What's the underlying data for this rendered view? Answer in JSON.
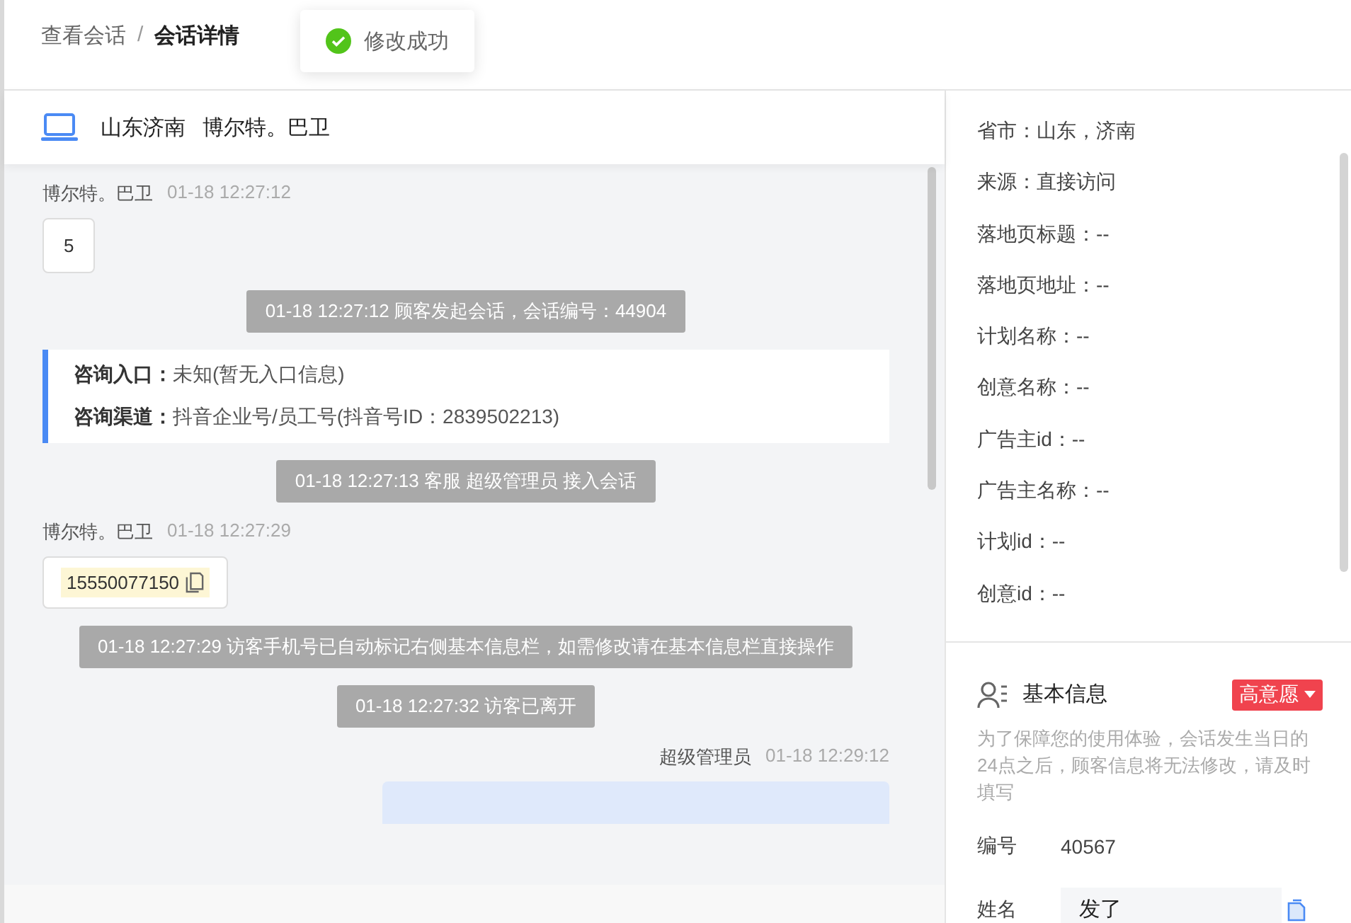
{
  "breadcrumb": [
    {
      "label": "查看会话",
      "current": false
    },
    {
      "label": "会话详情",
      "current": true
    }
  ],
  "breadcrumb_separator": "/",
  "toast": {
    "kind": "success",
    "text": "修改成功"
  },
  "visitor": {
    "location": "山东济南",
    "name": "博尔特。巴卫"
  },
  "messages": [
    {
      "kind": "visitor",
      "sender": "博尔特。巴卫",
      "time": "01-18 12:27:12",
      "text": "5"
    },
    {
      "kind": "system",
      "text": "01-18 12:27:12 顾客发起会话，会话编号：44904"
    },
    {
      "kind": "info",
      "lines": [
        {
          "label": "咨询入口：",
          "value": "未知(暂无入口信息)"
        },
        {
          "label": "咨询渠道：",
          "value": "抖音企业号/员工号(抖音号ID：2839502213)"
        }
      ]
    },
    {
      "kind": "system",
      "text": "01-18 12:27:13 客服 超级管理员 接入会话"
    },
    {
      "kind": "phone",
      "sender": "博尔特。巴卫",
      "time": "01-18 12:27:29",
      "text": "15550077150"
    },
    {
      "kind": "system",
      "text": "01-18 12:27:29 访客手机号已自动标记右侧基本信息栏，如需修改请在基本信息栏直接操作"
    },
    {
      "kind": "system",
      "text": "01-18 12:27:32 访客已离开"
    },
    {
      "kind": "agent",
      "sender": "超级管理员",
      "time": "01-18 12:29:12"
    }
  ],
  "details": [
    "省市：山东，济南",
    "来源：直接访问",
    "落地页标题：--",
    "落地页地址：--",
    "计划名称：--",
    "创意名称：--",
    "广告主id：--",
    "广告主名称：--",
    "计划id：--",
    "创意id：--"
  ],
  "basic_info": {
    "title": "基本信息",
    "intent": "高意愿",
    "note": "为了保障您的使用体验，会话发生当日的24点之后，顾客信息将无法修改，请及时填写",
    "fields": [
      {
        "kind": "text",
        "label": "编号",
        "value": "40567"
      },
      {
        "kind": "input",
        "label": "姓名",
        "value": "发了"
      }
    ]
  }
}
